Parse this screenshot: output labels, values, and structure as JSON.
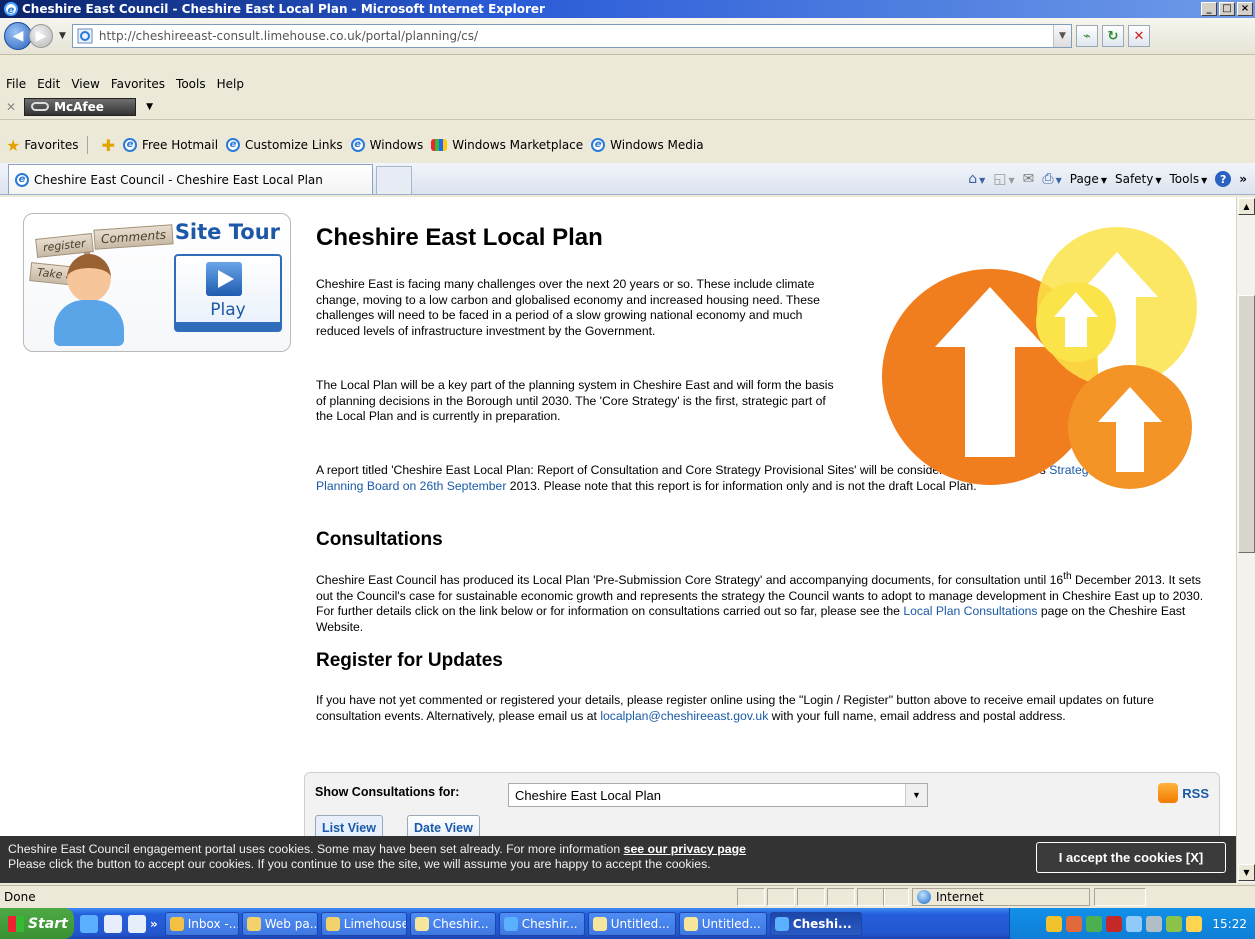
{
  "window": {
    "title": "Cheshire East Council - Cheshire East Local Plan - Microsoft Internet Explorer",
    "min": "_",
    "max": "□",
    "close": "×"
  },
  "address": {
    "url": "http://cheshireeast-consult.limehouse.co.uk/portal/planning/cs/"
  },
  "menu": [
    "File",
    "Edit",
    "View",
    "Favorites",
    "Tools",
    "Help"
  ],
  "mcafee": {
    "label": "McAfee"
  },
  "favorites": {
    "label": "Favorites",
    "links": [
      "Free Hotmail",
      "Customize Links",
      "Windows",
      "Windows Marketplace",
      "Windows Media"
    ]
  },
  "tab": {
    "title": "Cheshire East Council - Cheshire East Local Plan"
  },
  "commandbar": {
    "page": "Page",
    "safety": "Safety",
    "tools": "Tools"
  },
  "sitetour": {
    "title": "Site Tour",
    "signs": [
      "register",
      "Comments",
      "Take a tour"
    ],
    "play": "Play"
  },
  "main": {
    "title": "Cheshire East Local Plan",
    "p1": "Cheshire East is facing many challenges over the next 20 years or so.  These include climate change, moving to a low carbon and globalised economy and increased housing need.  These challenges will need to be faced in a period of a slow growing national economy and much reduced levels of infrastructure investment by the Government.",
    "p2": "The Local Plan will be a key part of the planning system in Cheshire East and will form the basis of planning decisions in the Borough until 2030.  The 'Core Strategy' is the first, strategic part of the Local Plan and is currently in preparation.",
    "p3_before": "A report titled 'Cheshire East Local Plan: Report of Consultation and Core Strategy Provisional Sites' will be considered by the Council's ",
    "p3_link": "Strategic Planning Board on 26th September",
    "p3_after": " 2013.  Please note that this report is for information only and is not the draft Local Plan.",
    "h_consultations": "Consultations",
    "p4_before": "Cheshire East Council has produced its Local Plan 'Pre-Submission Core Strategy' and accompanying documents, for consultation until 16",
    "p4_sup": "th",
    "p4_mid": " December 2013. It sets out the Council's case for sustainable economic growth and represents the strategy the Council wants to adopt to manage development in Cheshire East up to 2030. For further details click on the link below or for information on consultations carried out so far, please see the ",
    "p4_link": "Local Plan Consultations",
    "p4_after": " page on the Cheshire East Website.",
    "h_register": "Register for Updates",
    "p5_before": "If you have not yet commented or registered your details, please register online using the \"Login / Register\" button above to receive email updates on future consultation events.  Alternatively, please email us at ",
    "p5_link": "localplan@cheshireeast.gov.uk",
    "p5_after": " with your full name, email address and postal address."
  },
  "consultpanel": {
    "label": "Show Consultations for:",
    "selected": "Cheshire East Local Plan",
    "rss": "RSS",
    "tabs": [
      "List View",
      "Date View"
    ]
  },
  "cookie": {
    "line1_before": "Cheshire East Council engagement portal uses cookies. Some may have been set already. For more information ",
    "line1_link": "see our privacy page",
    "line2": "Please click the button to accept our cookies. If you continue to use the site, we will assume you are happy to accept the cookies.",
    "button": "I accept the cookies [X]"
  },
  "status": {
    "text": "Done",
    "zone": "Internet"
  },
  "taskbar": {
    "start": "Start",
    "buttons": [
      "Inbox -...",
      "Web pa...",
      "Limehouse",
      "Cheshir...",
      "Cheshir...",
      "Untitled...",
      "Untitled...",
      "Cheshi..."
    ],
    "time": "15:22"
  },
  "colors": {
    "arrowOrange": "#f07d1e",
    "arrowYellow": "#fbe34a",
    "link": "#1a5aa8"
  }
}
